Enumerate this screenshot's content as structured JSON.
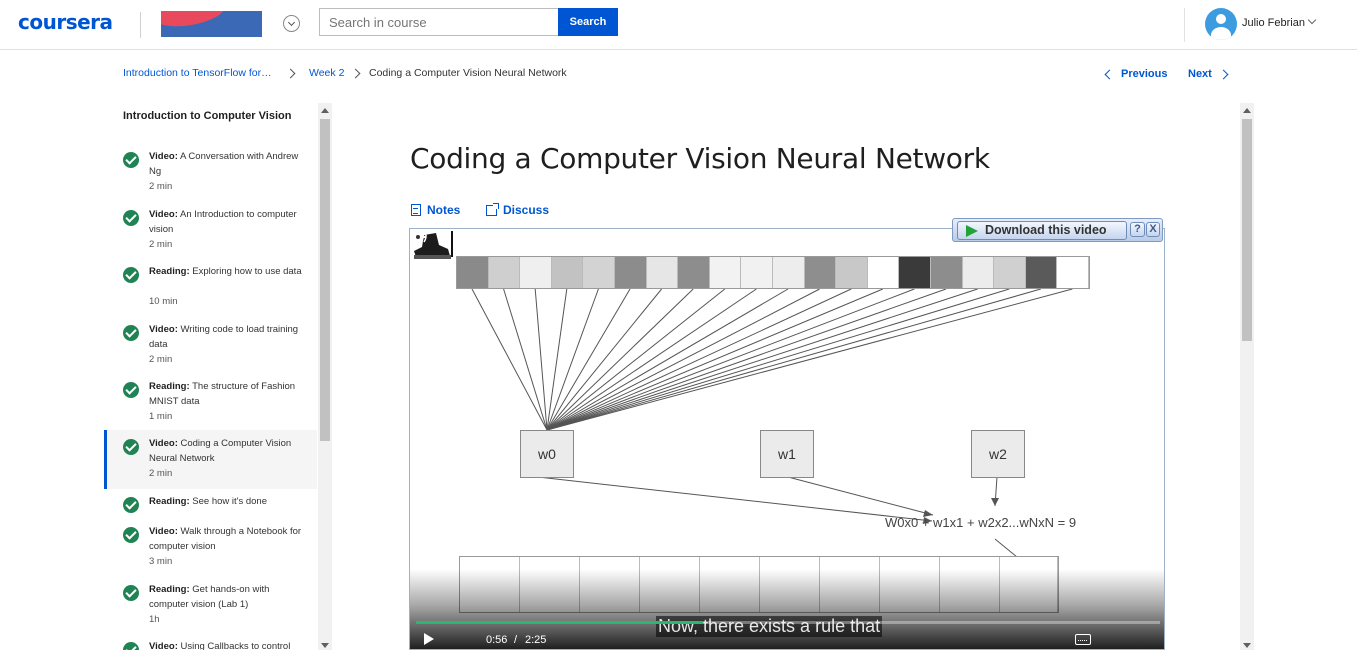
{
  "header": {
    "logo_text": "coursera",
    "search_placeholder": "Search in course",
    "search_button": "Search",
    "user_name": "Julio Febrian",
    "brand_color": "#0056d2"
  },
  "breadcrumb": {
    "items": [
      "Introduction to TensorFlow for…",
      "Week 2",
      "Coding a Computer Vision Neural Network"
    ],
    "previous": "Previous",
    "next": "Next"
  },
  "sidebar": {
    "title": "Introduction to Computer Vision",
    "items": [
      {
        "type": "Video:",
        "title": "A Conversation with Andrew Ng",
        "duration": "2 min",
        "completed": true,
        "active": false
      },
      {
        "type": "Video:",
        "title": "An Introduction to computer vision",
        "duration": "2 min",
        "completed": true,
        "active": false
      },
      {
        "type": "Reading:",
        "title": "Exploring how to use data",
        "duration": "10 min",
        "completed": true,
        "active": false
      },
      {
        "type": "Video:",
        "title": "Writing code to load training data",
        "duration": "2 min",
        "completed": true,
        "active": false
      },
      {
        "type": "Reading:",
        "title": "The structure of Fashion MNIST data",
        "duration": "1 min",
        "completed": true,
        "active": false
      },
      {
        "type": "Video:",
        "title": "Coding a Computer Vision Neural Network",
        "duration": "2 min",
        "completed": true,
        "active": true
      },
      {
        "type": "Reading:",
        "title": "See how it's done",
        "duration": "",
        "completed": true,
        "active": false
      },
      {
        "type": "Video:",
        "title": "Walk through a Notebook for computer vision",
        "duration": "3 min",
        "completed": true,
        "active": false
      },
      {
        "type": "Reading:",
        "title": "Get hands-on with computer vision (Lab 1)",
        "duration": "1h",
        "completed": true,
        "active": false
      },
      {
        "type": "Video:",
        "title": "Using Callbacks to control",
        "duration": "",
        "completed": true,
        "active": false
      }
    ]
  },
  "main": {
    "title": "Coding a Computer Vision Neural Network",
    "notes_label": "Notes",
    "discuss_label": "Discuss"
  },
  "video": {
    "pixel_shades": [
      "#8a8a8a",
      "#cfcfcf",
      "#efefef",
      "#c2c2c2",
      "#d3d3d3",
      "#8c8c8c",
      "#e6e6e6",
      "#8d8d8d",
      "#f2f2f2",
      "#f1f1f1",
      "#ededed",
      "#8e8e8e",
      "#c8c8c8",
      "#ffffff",
      "#3a3a3a",
      "#8d8d8d",
      "#ececec",
      "#d0d0d0",
      "#5a5a5a",
      "#ffffff"
    ],
    "weights": [
      "w0",
      "w1",
      "w2"
    ],
    "formula": "W0x0 + w1x1 + w2x2...wNxN = 9",
    "caption": "Now, there exists a rule that",
    "current_time": "0:56",
    "time_separator": "/",
    "duration": "2:25",
    "progress": 0.386,
    "download_label": "Download this video",
    "help_label": "?",
    "close_label": "X"
  }
}
